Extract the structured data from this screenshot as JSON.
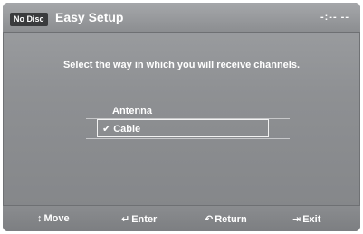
{
  "header": {
    "badge": "No Disc",
    "title": "Easy Setup",
    "time": "-:-- --"
  },
  "main": {
    "prompt": "Select the way in which you will receive channels.",
    "options": [
      {
        "label": "Antenna",
        "selected": false
      },
      {
        "label": "Cable",
        "selected": true
      }
    ],
    "check_glyph": "✔"
  },
  "footer": {
    "move": {
      "icon": "up-down-arrow-icon",
      "glyph": "↕",
      "label": "Move"
    },
    "enter": {
      "icon": "enter-icon",
      "glyph": "↵",
      "label": "Enter"
    },
    "return": {
      "icon": "return-icon",
      "glyph": "↶",
      "label": "Return"
    },
    "exit": {
      "icon": "exit-icon",
      "glyph": "⇥",
      "label": "Exit"
    }
  }
}
